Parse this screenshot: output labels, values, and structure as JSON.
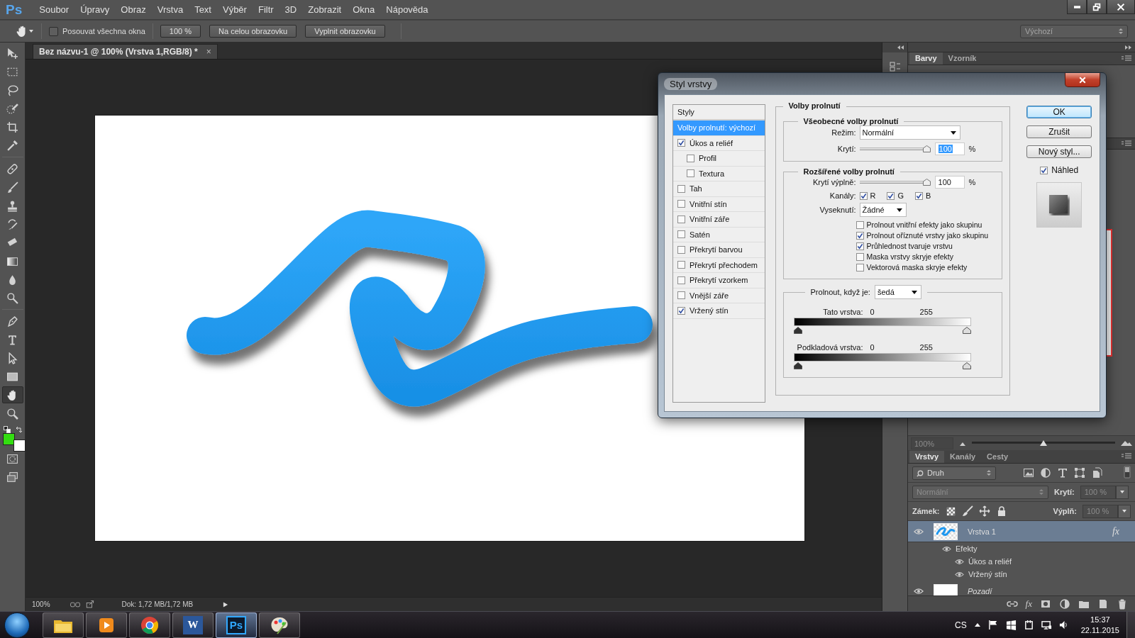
{
  "app_logo": "Ps",
  "menu": [
    "Soubor",
    "Úpravy",
    "Obraz",
    "Vrstva",
    "Text",
    "Výběr",
    "Filtr",
    "3D",
    "Zobrazit",
    "Okna",
    "Nápověda"
  ],
  "window_controls": [
    {
      "kind": "minimize"
    },
    {
      "kind": "restore"
    },
    {
      "kind": "close"
    }
  ],
  "options_bar": {
    "scroll_all": {
      "label": "Posouvat všechna okna",
      "checked": false
    },
    "buttons": [
      "100 %",
      "Na celou obrazovku",
      "Vyplnit obrazovku"
    ],
    "workspace": "Výchozí"
  },
  "tools": [
    {
      "kind": "move",
      "selected": false
    },
    {
      "kind": "marquee",
      "selected": false
    },
    {
      "kind": "lasso",
      "selected": false
    },
    {
      "kind": "quick_select",
      "selected": false
    },
    {
      "kind": "crop",
      "selected": false
    },
    {
      "kind": "eyedropper",
      "selected": false
    },
    {
      "kind": "healing",
      "selected": false
    },
    {
      "kind": "brush",
      "selected": false
    },
    {
      "kind": "stamp",
      "selected": false
    },
    {
      "kind": "history_brush",
      "selected": false
    },
    {
      "kind": "eraser",
      "selected": false
    },
    {
      "kind": "gradient",
      "selected": false
    },
    {
      "kind": "blur",
      "selected": false
    },
    {
      "kind": "dodge",
      "selected": false
    },
    {
      "kind": "pen",
      "selected": false
    },
    {
      "kind": "type",
      "selected": false
    },
    {
      "kind": "path_select",
      "selected": false
    },
    {
      "kind": "shape",
      "selected": false
    },
    {
      "kind": "hand",
      "selected": true
    },
    {
      "kind": "zoom",
      "selected": false
    }
  ],
  "color_swatches": [
    {
      "color": "#33dd11"
    },
    {
      "color": "#ffffff"
    }
  ],
  "document": {
    "tab_title": "Bez názvu-1 @ 100% (Vrstva 1,RGB/8) *",
    "close": "×",
    "zoom": "100%",
    "doc_info": "Dok: 1,72 MB/1,72 MB"
  },
  "color_panel": {
    "tabs": [
      {
        "label": "Barvy",
        "selected": true
      },
      {
        "label": "Vzorník",
        "selected": false
      }
    ]
  },
  "navigator": {
    "zoom": "100%",
    "level": 0.5
  },
  "layers_panel": {
    "tabs": [
      {
        "label": "Vrstvy",
        "selected": true
      },
      {
        "label": "Kanály",
        "selected": false
      },
      {
        "label": "Cesty",
        "selected": false
      }
    ],
    "filter": "Druh",
    "blend_mode": "Normální",
    "opacity_label": "Krytí:",
    "opacity": "100 %",
    "lock_label": "Zámek:",
    "fill_label": "Výplň:",
    "fill": "100 %",
    "layers": [
      {
        "name": "Vrstva 1",
        "selected": true,
        "visible": true,
        "fx": "fx",
        "effects_label": "Efekty",
        "effects": [
          {
            "name": "Úkos a reliéf",
            "visible": true
          },
          {
            "name": "Vržený stín",
            "visible": true
          }
        ]
      },
      {
        "name": "Pozadí",
        "selected": false,
        "visible": true
      }
    ],
    "footer_fx": "fx"
  },
  "dialog": {
    "title": "Styl vrstvy",
    "styles_header": "Styly",
    "styles": [
      {
        "label": "Volby prolnutí: výchozí",
        "kind": "header",
        "selected": true
      },
      {
        "label": "Úkos a reliéf",
        "kind": "check",
        "checked": true,
        "selected": false,
        "children": [
          {
            "label": "Profil",
            "kind": "check",
            "checked": false,
            "selected": false
          },
          {
            "label": "Textura",
            "kind": "check",
            "checked": false,
            "selected": false
          }
        ]
      },
      {
        "label": "Tah",
        "kind": "check",
        "checked": false,
        "selected": false
      },
      {
        "label": "Vnitřní stín",
        "kind": "check",
        "checked": false,
        "selected": false
      },
      {
        "label": "Vnitřní záře",
        "kind": "check",
        "checked": false,
        "selected": false
      },
      {
        "label": "Satén",
        "kind": "check",
        "checked": false,
        "selected": false
      },
      {
        "label": "Překrytí barvou",
        "kind": "check",
        "checked": false,
        "selected": false
      },
      {
        "label": "Překrytí přechodem",
        "kind": "check",
        "checked": false,
        "selected": false
      },
      {
        "label": "Překrytí vzorkem",
        "kind": "check",
        "checked": false,
        "selected": false
      },
      {
        "label": "Vnější záře",
        "kind": "check",
        "checked": false,
        "selected": false
      },
      {
        "label": "Vržený stín",
        "kind": "check",
        "checked": true,
        "selected": false
      }
    ],
    "blending": {
      "title": "Volby prolnutí",
      "general": {
        "title": "Všeobecné volby prolnutí",
        "mode_label": "Režim:",
        "mode": "Normální",
        "opacity_label": "Krytí:",
        "opacity": {
          "level": 1,
          "value": "100",
          "selected": true
        },
        "unit": "%"
      },
      "advanced": {
        "title": "Rozšířené volby prolnutí",
        "fill_label": "Krytí výplně:",
        "fill": {
          "level": 1,
          "value": "100",
          "selected": false
        },
        "unit": "%",
        "channels_label": "Kanály:",
        "channels": [
          {
            "label": "R",
            "checked": true
          },
          {
            "label": "G",
            "checked": true
          },
          {
            "label": "B",
            "checked": true
          }
        ],
        "knockout_label": "Vyseknutí:",
        "knockout": "Žádné",
        "options": [
          {
            "label": "Prolnout vnitřní efekty jako skupinu",
            "checked": false
          },
          {
            "label": "Prolnout oříznuté vrstvy jako skupinu",
            "checked": true
          },
          {
            "label": "Průhlednost tvaruje vrstvu",
            "checked": true
          },
          {
            "label": "Maska vrstvy skryje efekty",
            "checked": false
          },
          {
            "label": "Vektorová maska skryje efekty",
            "checked": false
          }
        ]
      },
      "blend_if": {
        "label": "Prolnout, když je:",
        "value": "šedá",
        "ranges": [
          {
            "label": "Tato vrstva:",
            "low": "0",
            "high": "255",
            "handles": [
              {
                "level": 0
              },
              {
                "level": 1
              }
            ]
          },
          {
            "label": "Podkladová vrstva:",
            "low": "0",
            "high": "255",
            "handles": [
              {
                "level": 0
              },
              {
                "level": 1
              }
            ]
          }
        ]
      }
    },
    "buttons": [
      {
        "label": "OK",
        "default": true
      },
      {
        "label": "Zrušit",
        "default": false
      },
      {
        "label": "Nový styl...",
        "default": false
      }
    ],
    "preview": {
      "label": "Náhled",
      "checked": true
    }
  },
  "taskbar": {
    "apps": [
      {
        "kind": "explorer",
        "selected": false
      },
      {
        "kind": "media",
        "selected": false
      },
      {
        "kind": "chrome",
        "selected": false
      },
      {
        "kind": "word",
        "glyph": "W",
        "selected": false
      },
      {
        "kind": "photoshop",
        "glyph": "Ps",
        "selected": true
      },
      {
        "kind": "paint",
        "selected": false
      }
    ],
    "language": "CS",
    "time": "15:37",
    "date": "22.11.2015"
  }
}
